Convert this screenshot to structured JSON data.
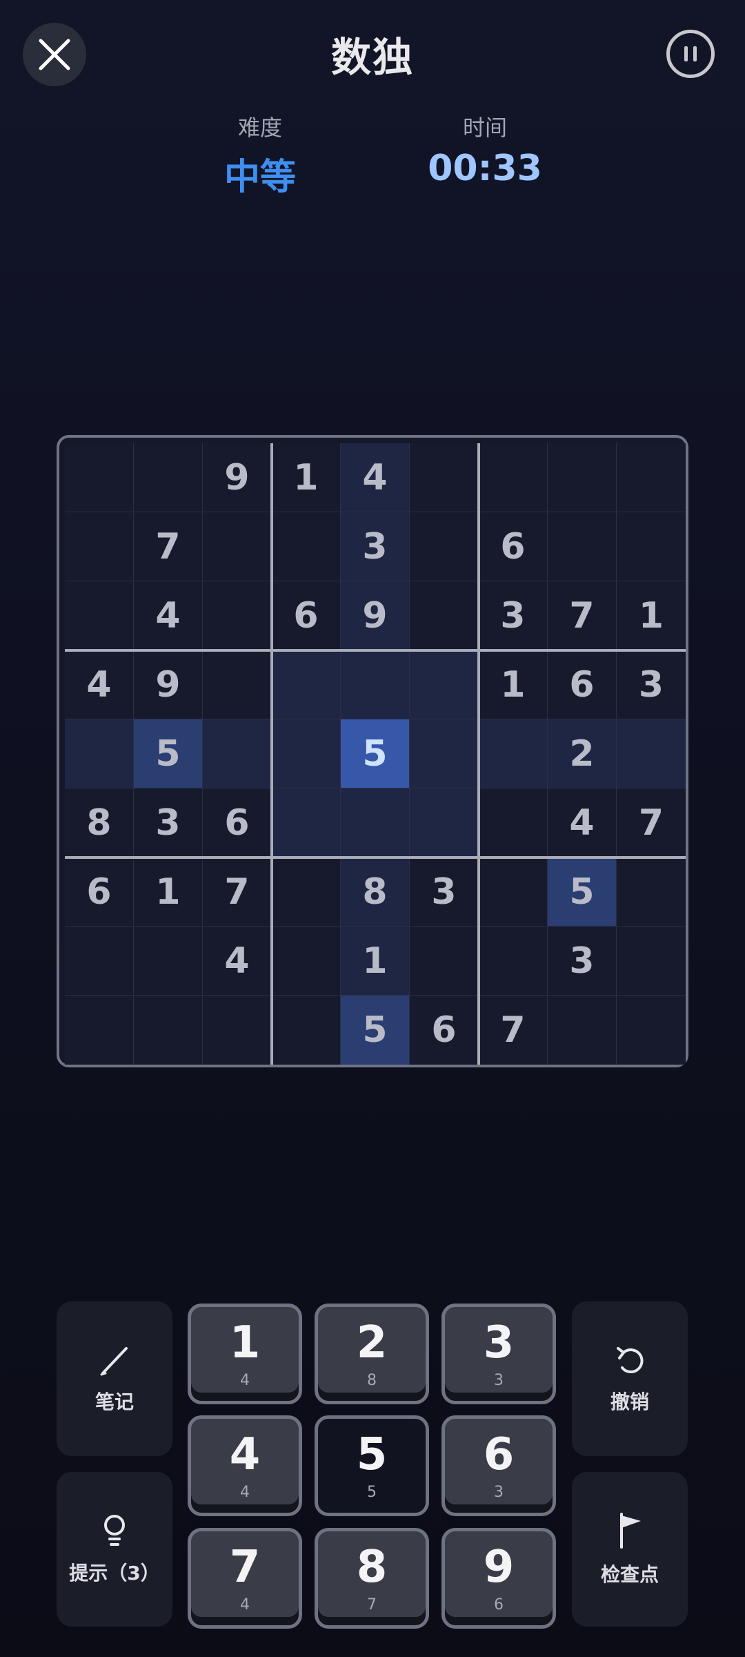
{
  "header": {
    "title": "数独",
    "difficulty_label": "难度",
    "difficulty_value": "中等",
    "time_label": "时间",
    "time_value": "00:33"
  },
  "board": {
    "cells": [
      [
        "",
        "",
        "9",
        "1",
        "4",
        "",
        "",
        "",
        ""
      ],
      [
        "",
        "7",
        "",
        "",
        "3",
        "",
        "6",
        "",
        ""
      ],
      [
        "",
        "4",
        "",
        "6",
        "9",
        "",
        "3",
        "7",
        "1"
      ],
      [
        "4",
        "9",
        "",
        "",
        "",
        "",
        "1",
        "6",
        "3"
      ],
      [
        "",
        "5",
        "",
        "",
        "5",
        "",
        "",
        "2",
        ""
      ],
      [
        "8",
        "3",
        "6",
        "",
        "",
        "",
        "",
        "4",
        "7"
      ],
      [
        "6",
        "1",
        "7",
        "",
        "8",
        "3",
        "",
        "5",
        ""
      ],
      [
        "",
        "",
        "4",
        "",
        "1",
        "",
        "",
        "3",
        ""
      ],
      [
        "",
        "",
        "",
        "",
        "5",
        "6",
        "7",
        "",
        ""
      ]
    ],
    "selected": [
      4,
      4
    ],
    "selected_digit": "5"
  },
  "controls": {
    "note_label": "笔记",
    "hint_label": "提示（3）",
    "undo_label": "撤销",
    "checkpoint_label": "检查点",
    "numbers": [
      {
        "digit": "1",
        "count": "4"
      },
      {
        "digit": "2",
        "count": "8"
      },
      {
        "digit": "3",
        "count": "3"
      },
      {
        "digit": "4",
        "count": "4"
      },
      {
        "digit": "5",
        "count": "5"
      },
      {
        "digit": "6",
        "count": "3"
      },
      {
        "digit": "7",
        "count": "4"
      },
      {
        "digit": "8",
        "count": "7"
      },
      {
        "digit": "9",
        "count": "6"
      }
    ]
  }
}
